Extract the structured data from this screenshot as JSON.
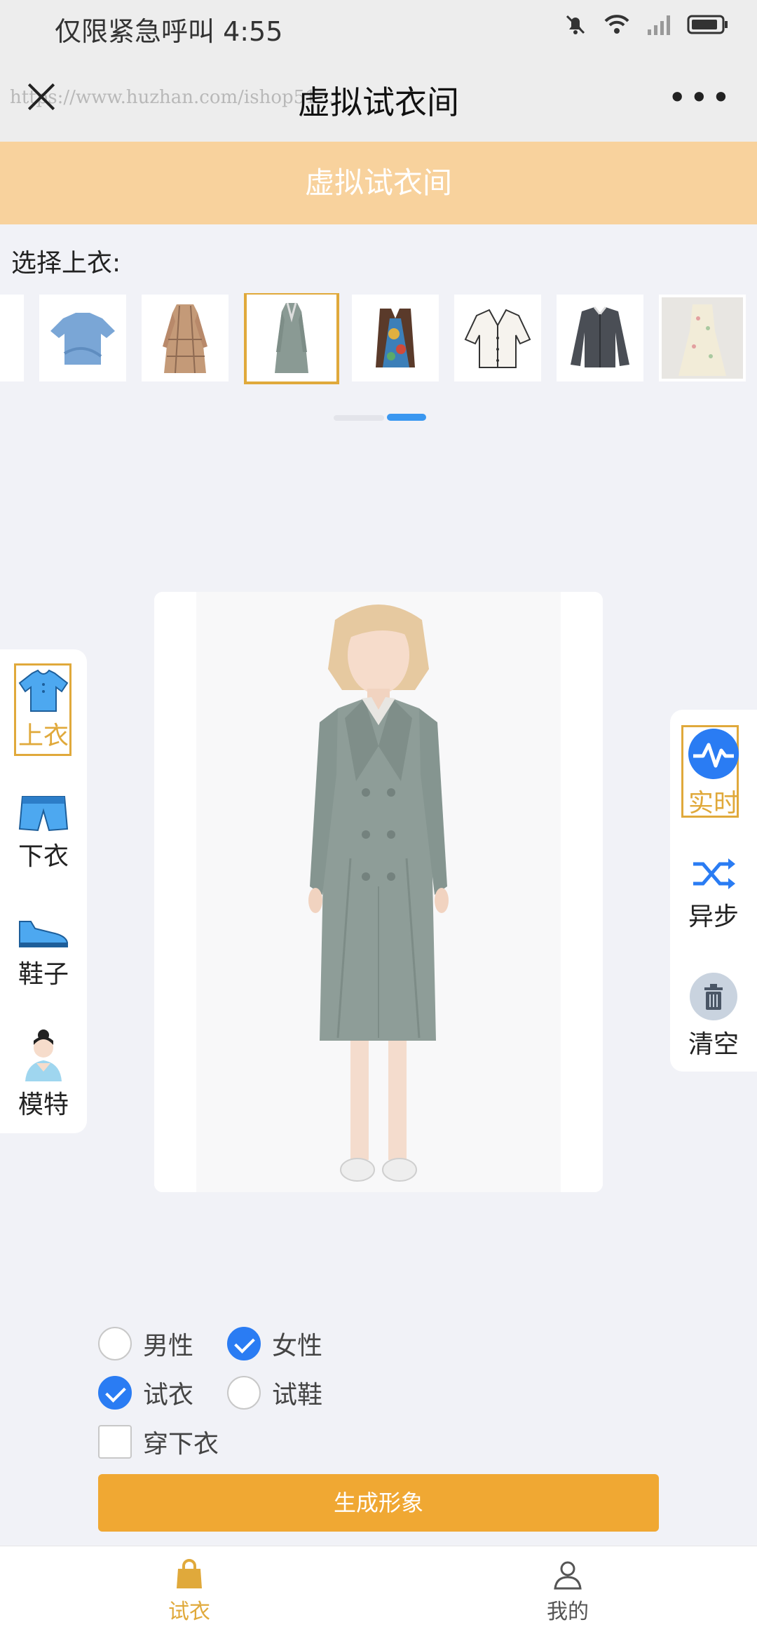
{
  "status_bar": {
    "text": "仅限紧急呼叫 4:55"
  },
  "nav": {
    "title": "虚拟试衣间",
    "more": "•••",
    "watermark": "https://www.huzhan.com/ishop51..."
  },
  "banner": {
    "title": "虚拟试衣间"
  },
  "select_label": "选择上衣:",
  "clothes": [
    {
      "name": "cloth-blue-top",
      "selected": false
    },
    {
      "name": "cloth-plaid-dress",
      "selected": false
    },
    {
      "name": "cloth-gray-coat-dress",
      "selected": true
    },
    {
      "name": "cloth-patterned-vest",
      "selected": false
    },
    {
      "name": "cloth-white-blouse",
      "selected": false
    },
    {
      "name": "cloth-dark-cardigan",
      "selected": false
    },
    {
      "name": "cloth-floral-dress",
      "selected": false
    }
  ],
  "left_tools": [
    {
      "label": "上衣",
      "icon": "shirt-icon",
      "active": true
    },
    {
      "label": "下衣",
      "icon": "shorts-icon",
      "active": false
    },
    {
      "label": "鞋子",
      "icon": "shoe-icon",
      "active": false
    },
    {
      "label": "模特",
      "icon": "model-icon",
      "active": false
    }
  ],
  "right_tools": [
    {
      "label": "实时",
      "icon": "pulse-icon",
      "active": true
    },
    {
      "label": "异步",
      "icon": "shuffle-icon",
      "active": false
    },
    {
      "label": "清空",
      "icon": "trash-icon",
      "active": false
    }
  ],
  "options": {
    "male": "男性",
    "female": "女性",
    "try_clothes": "试衣",
    "try_shoes": "试鞋",
    "wear_bottom": "穿下衣"
  },
  "generate_button": "生成形象",
  "tabs": [
    {
      "label": "试衣",
      "icon": "bag-icon",
      "active": true
    },
    {
      "label": "我的",
      "icon": "user-icon",
      "active": false
    }
  ],
  "colors": {
    "accent": "#e0a93b",
    "button": "#f0a833",
    "banner": "#f8d29d",
    "check_blue": "#2a7cf3"
  }
}
